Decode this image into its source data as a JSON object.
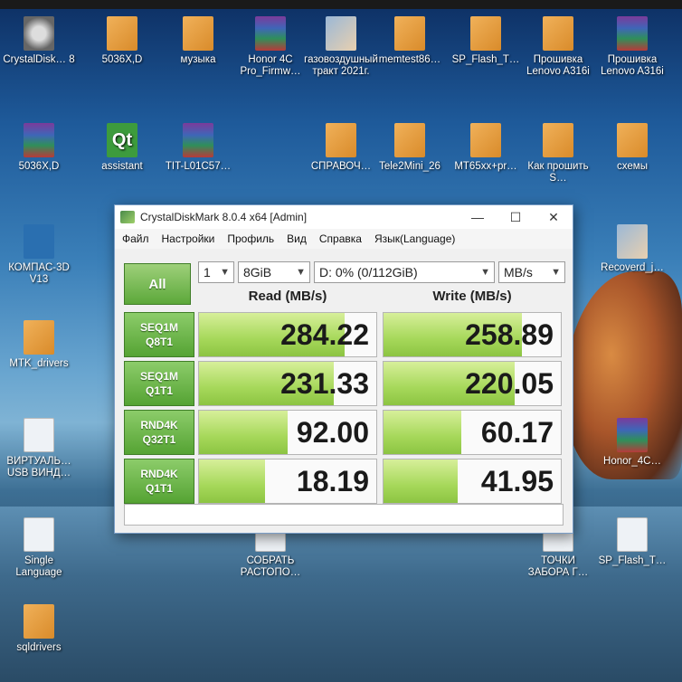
{
  "desktop": {
    "icons": [
      {
        "label": "CrystalDisk… 8",
        "icon": "disk-icon",
        "kind": "g-disk",
        "col": 0,
        "row": 0
      },
      {
        "label": "5036X,D",
        "icon": "folder-icon",
        "kind": "g-folder",
        "col": 1,
        "row": 0
      },
      {
        "label": "музыка",
        "icon": "folder-icon",
        "kind": "g-folder",
        "col": 2,
        "row": 0
      },
      {
        "label": "Honor 4C Pro_Firmw…",
        "icon": "rar-icon",
        "kind": "g-rar",
        "col": 3,
        "row": 0
      },
      {
        "label": "газовоздушный тракт 2021г.",
        "icon": "image-icon",
        "kind": "g-img",
        "col": 4,
        "row": 0
      },
      {
        "label": "memtest86…",
        "icon": "folder-icon",
        "kind": "g-folder",
        "col": 5,
        "row": 0
      },
      {
        "label": "SP_Flash_T…",
        "icon": "folder-icon",
        "kind": "g-folder",
        "col": 6,
        "row": 0
      },
      {
        "label": "Прошивка Lenovo A316i",
        "icon": "folder-icon",
        "kind": "g-folder",
        "col": 7,
        "row": 0
      },
      {
        "label": "Прошивка Lenovo A316i",
        "icon": "rar-icon",
        "kind": "g-rar",
        "col": 8,
        "row": 0
      },
      {
        "label": "5036X,D",
        "icon": "rar-icon",
        "kind": "g-rar",
        "col": 0,
        "row": 1
      },
      {
        "label": "assistant",
        "icon": "qt-icon",
        "kind": "g-qt",
        "col": 1,
        "row": 1
      },
      {
        "label": "TIT-L01C57…",
        "icon": "rar-icon",
        "kind": "g-rar",
        "col": 2,
        "row": 1
      },
      {
        "label": "СПРАВОЧ…",
        "icon": "folder-icon",
        "kind": "g-folder",
        "col": 4,
        "row": 1
      },
      {
        "label": "Tele2Mini_26",
        "icon": "folder-icon",
        "kind": "g-folder",
        "col": 5,
        "row": 1
      },
      {
        "label": "MT65xx+pr…",
        "icon": "folder-icon",
        "kind": "g-folder",
        "col": 6,
        "row": 1
      },
      {
        "label": "Как прошить S…",
        "icon": "folder-icon",
        "kind": "g-folder",
        "col": 7,
        "row": 1
      },
      {
        "label": "схемы",
        "icon": "folder-icon",
        "kind": "g-folder",
        "col": 8,
        "row": 1
      },
      {
        "label": "КОМПАС-3D V13",
        "icon": "app-icon",
        "kind": "g-app",
        "col": 0,
        "row": 2
      },
      {
        "label": "MTK_drivers",
        "icon": "folder-icon",
        "kind": "g-folder",
        "col": 0,
        "row": 3
      },
      {
        "label": "ВИРТУАЛЬ… USB ВИНД…",
        "icon": "doc-icon",
        "kind": "g-doc",
        "col": 0,
        "row": 4
      },
      {
        "label": "Single Language",
        "icon": "doc-icon",
        "kind": "g-doc",
        "col": 0,
        "row": 5
      },
      {
        "label": "sqldrivers",
        "icon": "folder-icon",
        "kind": "g-folder",
        "col": 0,
        "row": 6
      },
      {
        "label": "СОБРАТЬ РАСТОПО…",
        "icon": "doc-icon",
        "kind": "g-doc",
        "col": 3,
        "row": 5
      },
      {
        "label": "Recoverd_j…",
        "icon": "image-icon",
        "kind": "g-img",
        "col": 8,
        "row": 2
      },
      {
        "label": "Honor_4C…",
        "icon": "rar-icon",
        "kind": "g-rar",
        "col": 8,
        "row": 4
      },
      {
        "label": "ТОЧКИ ЗАБОРА Г…",
        "icon": "doc-icon",
        "kind": "g-doc",
        "col": 7,
        "row": 5
      },
      {
        "label": "SP_Flash_T…",
        "icon": "doc-icon",
        "kind": "g-doc",
        "col": 8,
        "row": 5
      }
    ]
  },
  "window": {
    "title": "CrystalDiskMark 8.0.4 x64 [Admin]",
    "minimize": "—",
    "maximize": "☐",
    "close": "✕",
    "menu": [
      "Файл",
      "Настройки",
      "Профиль",
      "Вид",
      "Справка",
      "Язык(Language)"
    ],
    "all_button": "All",
    "count": "1",
    "size": "8GiB",
    "drive": "D: 0% (0/112GiB)",
    "unit": "MB/s",
    "read_header": "Read (MB/s)",
    "write_header": "Write (MB/s)",
    "tests": [
      {
        "line1": "SEQ1M",
        "line2": "Q8T1",
        "read": "284.22",
        "write": "258.89",
        "read_frac": 0.82,
        "write_frac": 0.78
      },
      {
        "line1": "SEQ1M",
        "line2": "Q1T1",
        "read": "231.33",
        "write": "220.05",
        "read_frac": 0.76,
        "write_frac": 0.74
      },
      {
        "line1": "RND4K",
        "line2": "Q32T1",
        "read": "92.00",
        "write": "60.17",
        "read_frac": 0.5,
        "write_frac": 0.44
      },
      {
        "line1": "RND4K",
        "line2": "Q1T1",
        "read": "18.19",
        "write": "41.95",
        "read_frac": 0.37,
        "write_frac": 0.42
      }
    ],
    "comment": ""
  },
  "colors": {
    "accent_green": "#5ca83a",
    "bar_green": "#a6d85a"
  }
}
